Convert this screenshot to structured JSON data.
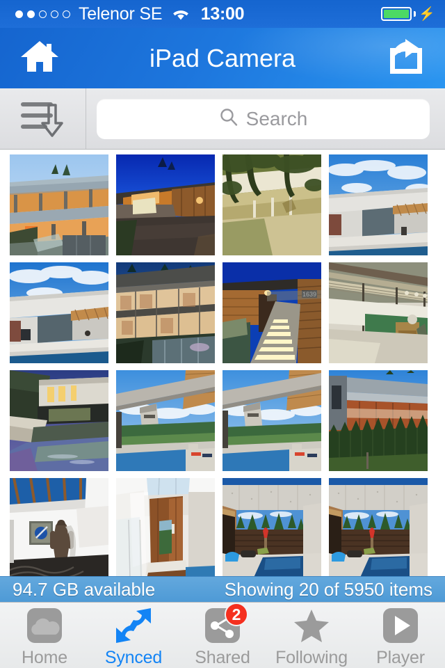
{
  "status_bar": {
    "signal_dots": [
      true,
      true,
      false,
      false,
      false
    ],
    "carrier": "Telenor SE",
    "wifi_icon": "wifi-icon",
    "time": "13:00",
    "battery_icon": "battery-full-icon",
    "charging_icon": "lightning-bolt-icon"
  },
  "nav_bar": {
    "title": "iPad Camera",
    "home_icon": "home-icon",
    "share_icon": "share-export-icon",
    "background_color": "#1d76dd"
  },
  "toolbar": {
    "sort_icon": "sort-descending-icon",
    "search": {
      "icon": "search-icon",
      "placeholder": "Search",
      "value": ""
    }
  },
  "grid": {
    "columns": 4,
    "photos": [
      {
        "id": 1,
        "alt": "Modern two-storey glass house at dusk with warm interior lighting"
      },
      {
        "id": 2,
        "alt": "Wood-clad house and driveway under deep blue twilight sky"
      },
      {
        "id": 3,
        "alt": "Cantilevered white house under large oak trees in golden sunlight"
      },
      {
        "id": 4,
        "alt": "White concrete house with lap pool under blue cloudy sky"
      },
      {
        "id": 5,
        "alt": "Concrete modern home beside swimming pool on sunny day"
      },
      {
        "id": 6,
        "alt": "Illuminated glass facade of hillside house at twilight"
      },
      {
        "id": 7,
        "alt": "Lit entry stairway of wood-panelled house at night"
      },
      {
        "id": 8,
        "alt": "Covered patio terrace with green lawn and lounge furniture"
      },
      {
        "id": 9,
        "alt": "Hillside house with reflecting infinity pool at dusk"
      },
      {
        "id": 10,
        "alt": "Concrete beam over pool deck with valley view"
      },
      {
        "id": 11,
        "alt": "Concrete canopy over pool terrace with distant treeline"
      },
      {
        "id": 12,
        "alt": "Long metal-roofed house behind a row of tall cedar hedges"
      },
      {
        "id": 13,
        "alt": "White gallery interior with skylight beams and bronze statue"
      },
      {
        "id": 14,
        "alt": "Entry hall with tall wooden pivot door and glass stair rail"
      },
      {
        "id": 15,
        "alt": "Concrete courtyard house with pool and red umbrella"
      },
      {
        "id": 16,
        "alt": "Concrete courtyard house with pool and red umbrella"
      }
    ]
  },
  "info_bar": {
    "storage": "94.7 GB available",
    "items": "Showing 20 of 5950 items"
  },
  "tab_bar": {
    "active_color": "#1384f5",
    "inactive_color": "#9b9b9b",
    "tabs": [
      {
        "label": "Home",
        "icon": "cloud-icon",
        "active": false,
        "badge": ""
      },
      {
        "label": "Synced",
        "icon": "sync-arrows-icon",
        "active": true,
        "badge": ""
      },
      {
        "label": "Shared",
        "icon": "share-nodes-icon",
        "active": false,
        "badge": "2"
      },
      {
        "label": "Following",
        "icon": "star-icon",
        "active": false,
        "badge": ""
      },
      {
        "label": "Player",
        "icon": "play-icon",
        "active": false,
        "badge": ""
      }
    ]
  }
}
